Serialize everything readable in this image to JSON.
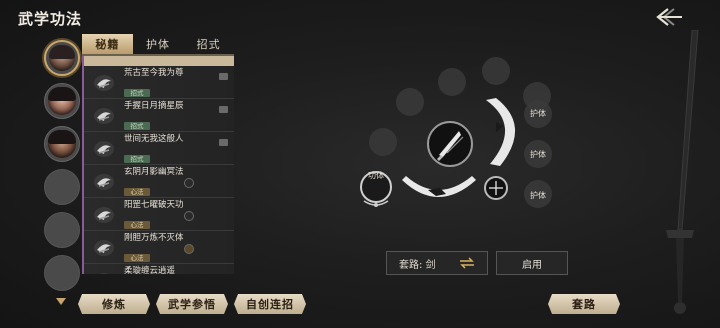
{
  "window": {
    "title": "武学功法"
  },
  "tabs": [
    {
      "label": "秘籍",
      "active": true
    },
    {
      "label": "护体",
      "active": false
    },
    {
      "label": "招式",
      "active": false
    }
  ],
  "skills": [
    {
      "name": "荒古至今我为尊",
      "tag": "招式",
      "icon": "claw-icon",
      "tag_type": "zhaoshi"
    },
    {
      "name": "手握日月摘星辰",
      "tag": "招式",
      "icon": "claw-icon",
      "tag_type": "zhaoshi"
    },
    {
      "name": "世间无我这般人",
      "tag": "招式",
      "icon": "claw-icon",
      "tag_type": "zhaoshi"
    },
    {
      "name": "玄阴月影幽冥法",
      "tag": "心法",
      "icon": "claw-icon",
      "tag_type": "neigong"
    },
    {
      "name": "阳罡七曜破天功",
      "tag": "心法",
      "icon": "claw-icon",
      "tag_type": "neigong"
    },
    {
      "name": "刚胆万炼不灭体",
      "tag": "心法",
      "icon": "claw-icon",
      "tag_type": "neigong"
    },
    {
      "name": "柔璇缠云逍遥",
      "tag": "",
      "icon": "claw-icon",
      "tag_type": ""
    }
  ],
  "bottom_buttons": {
    "practice": "修炼",
    "comprehend": "武学参悟",
    "custom_combo": "自创连招",
    "routine": "套路"
  },
  "wheel": {
    "gongti_label": "功体",
    "huti_labels": [
      "护体",
      "护体",
      "护体"
    ]
  },
  "config": {
    "routine_label": "套路: 剑",
    "enable_label": "启用"
  },
  "colors": {
    "accent": "#c9a66b",
    "tab_active": "#e6d3b2",
    "tag_green": "#4b6a52"
  }
}
